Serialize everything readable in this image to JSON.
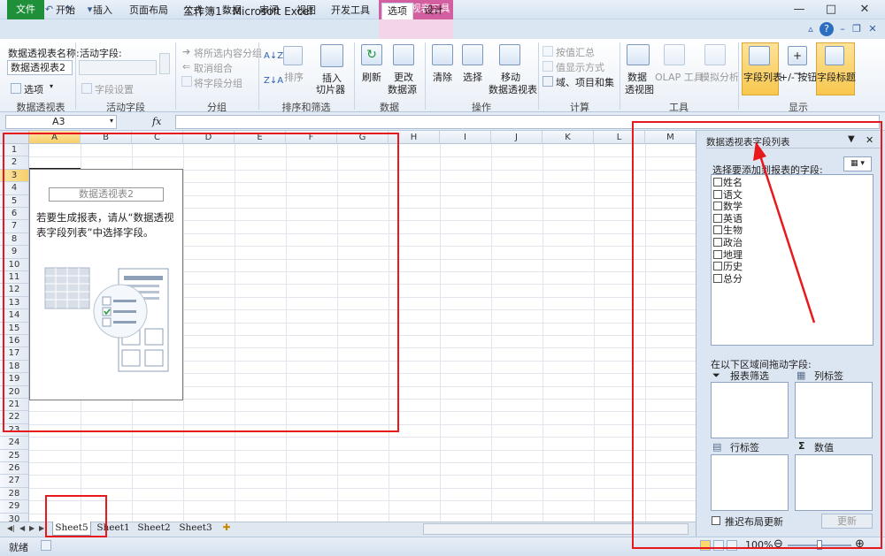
{
  "title_bar": {
    "title": "工作簿1 - Microsoft Excel",
    "context_group": "数据透视表工具",
    "controls": [
      "—",
      "□",
      "✕"
    ]
  },
  "tabs": [
    "文件",
    "开始",
    "插入",
    "页面布局",
    "公式",
    "数据",
    "审阅",
    "视图",
    "开发工具",
    "选项",
    "设计"
  ],
  "ribbon": {
    "pivot_name_label": "数据透视表名称:",
    "pivot_name_value": "数据透视表2",
    "options_btn": "选项",
    "group_pivot": "数据透视表",
    "active_field_label": "活动字段:",
    "field_settings": "字段设置",
    "group_active_field": "活动字段",
    "group_sel": "将所选内容分组",
    "ungroup": "取消组合",
    "group_field": "将字段分组",
    "group_group": "分组",
    "sort": "排序",
    "insert_slicer_1": "插入",
    "insert_slicer_2": "切片器",
    "group_sort": "排序和筛选",
    "refresh": "刷新",
    "change_source_1": "更改",
    "change_source_2": "数据源",
    "group_data": "数据",
    "clear": "清除",
    "select": "选择",
    "move_1": "移动",
    "move_2": "数据透视表",
    "group_ops": "操作",
    "summarize_by": "按值汇总",
    "show_values": "值显示方式",
    "fields_items": "域、项目和集",
    "group_calc": "计算",
    "pivot_chart_1": "数据",
    "pivot_chart_2": "透视图",
    "olap": "OLAP 工具",
    "whatif": "模拟分析",
    "group_tools": "工具",
    "field_list": "字段列表",
    "plus_minus": "+/- 按钮",
    "field_headers": "字段标题",
    "group_show": "显示"
  },
  "formula_bar": {
    "name_box": "A3",
    "fx": "fx",
    "formula": ""
  },
  "grid": {
    "columns": [
      "A",
      "B",
      "C",
      "D",
      "E",
      "F",
      "G",
      "H",
      "I",
      "J",
      "K",
      "L",
      "M"
    ],
    "rows": [
      "1",
      "2",
      "3",
      "4",
      "5",
      "6",
      "7",
      "8",
      "9",
      "10",
      "11",
      "12",
      "13",
      "14",
      "15",
      "16",
      "17",
      "18",
      "19",
      "20",
      "21",
      "22",
      "23",
      "24",
      "25",
      "26",
      "27",
      "28",
      "29",
      "30"
    ],
    "pivot_placeholder_name": "数据透视表2",
    "pivot_hint": "若要生成报表，请从“数据透视表字段列表”中选择字段。"
  },
  "sheets": [
    "Sheet5",
    "Sheet1",
    "Sheet2",
    "Sheet3"
  ],
  "status": {
    "ready": "就绪",
    "zoom": "100%"
  },
  "pane": {
    "title": "数据透视表字段列表",
    "choose_label": "选择要添加到报表的字段:",
    "fields": [
      "姓名",
      "语文",
      "数学",
      "英语",
      "生物",
      "政治",
      "地理",
      "历史",
      "总分"
    ],
    "drag_label": "在以下区域间拖动字段:",
    "report_filter": "报表筛选",
    "column_labels": "列标签",
    "row_labels": "行标签",
    "values": "数值",
    "defer_update": "推迟布局更新",
    "update_btn": "更新"
  },
  "colors": {
    "file_tab": "#1f8f3a",
    "context_tab": "#d35fa0",
    "annotation": "#e8191c"
  }
}
